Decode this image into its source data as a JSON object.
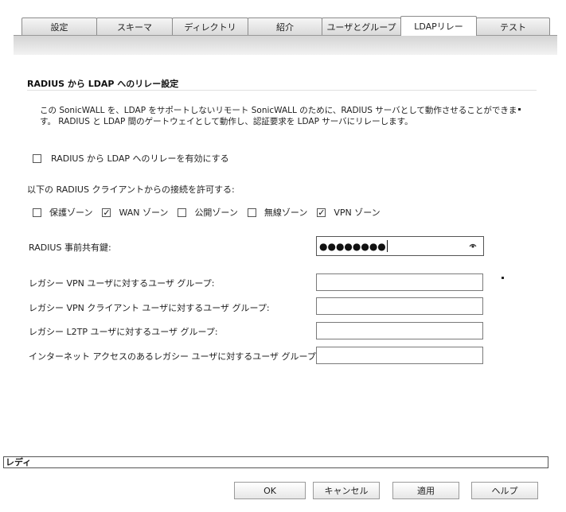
{
  "tabs": [
    {
      "label": "設定",
      "active": false
    },
    {
      "label": "スキーマ",
      "active": false
    },
    {
      "label": "ディレクトリ",
      "active": false
    },
    {
      "label": "紹介",
      "active": false
    },
    {
      "label": "ユーザとグループ",
      "active": false
    },
    {
      "label": "LDAPリレー",
      "active": true
    },
    {
      "label": "テスト",
      "active": false
    }
  ],
  "section": {
    "title": "RADIUS から LDAP へのリレー設定",
    "description_line1": "この SonicWALL を、LDAP をサポートしないリモート SonicWALL のために、RADIUS サーバとして動作させることができま",
    "description_line2": "す。 RADIUS と LDAP 間のゲートウェイとして動作し、認証要求を LDAP サーバにリレーします。"
  },
  "enable_relay": {
    "label": "RADIUS から LDAP へのリレーを有効にする",
    "checked": false
  },
  "allow_label": "以下の RADIUS クライアントからの接続を許可する:",
  "zones": [
    {
      "label": "保護ゾーン",
      "checked": false
    },
    {
      "label": "WAN ゾーン",
      "checked": true
    },
    {
      "label": "公開ゾーン",
      "checked": false
    },
    {
      "label": "無線ゾーン",
      "checked": false
    },
    {
      "label": "VPN ゾーン",
      "checked": true
    }
  ],
  "check_glyph": "✓",
  "shared_secret": {
    "label": "RADIUS 事前共有鍵:",
    "value": "●●●●●●●●"
  },
  "legacy_groups": [
    {
      "label": "レガシー VPN ユーザに対するユーザ グループ:",
      "value": ""
    },
    {
      "label": "レガシー VPN クライアント ユーザに対するユーザ グループ:",
      "value": ""
    },
    {
      "label": "レガシー L2TP ユーザに対するユーザ グループ:",
      "value": ""
    },
    {
      "label": "インターネット アクセスのあるレガシー ユーザに対するユーザ グループ:",
      "value": ""
    }
  ],
  "status": "レディ",
  "buttons": {
    "ok": "OK",
    "cancel": "キャンセル",
    "apply": "適用",
    "help": "ヘルプ"
  }
}
